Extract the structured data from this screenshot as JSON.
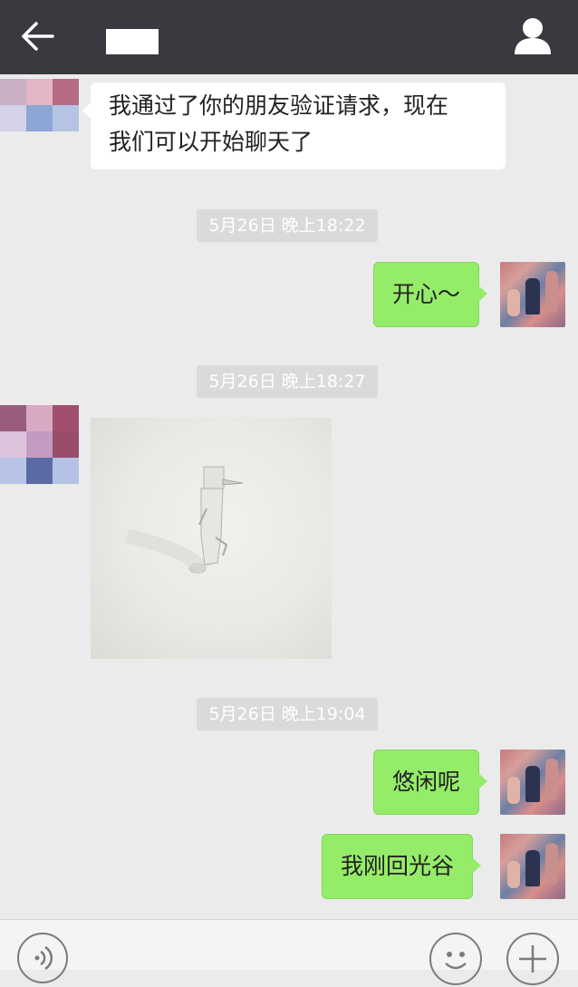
{
  "header": {
    "back_icon": "arrow-left-icon",
    "profile_icon": "person-icon",
    "bar_color": "#393a3f"
  },
  "messages": [
    {
      "side": "left",
      "type": "text",
      "text_line1": "我通过了你的朋友验证请求，现在",
      "text_line2": "我们可以开始聊天了"
    },
    {
      "type": "time",
      "text": "5月26日 晚上18:22"
    },
    {
      "side": "right",
      "type": "text",
      "text": "开心～"
    },
    {
      "type": "time",
      "text": "5月26日 晚上18:27"
    },
    {
      "side": "left",
      "type": "image"
    },
    {
      "type": "time",
      "text": "5月26日 晚上19:04"
    },
    {
      "side": "right",
      "type": "text",
      "text": "悠闲呢"
    },
    {
      "side": "right",
      "type": "text",
      "text": "我刚回光谷"
    }
  ],
  "input_bar": {
    "voice_icon": "voice-icon",
    "emoji_icon": "emoji-icon",
    "plus_icon": "plus-icon"
  },
  "colors": {
    "chat_bg": "#ebebeb",
    "bubble_mine": "#95ec69",
    "bubble_theirs": "#ffffff",
    "time_chip": "#dadada"
  }
}
